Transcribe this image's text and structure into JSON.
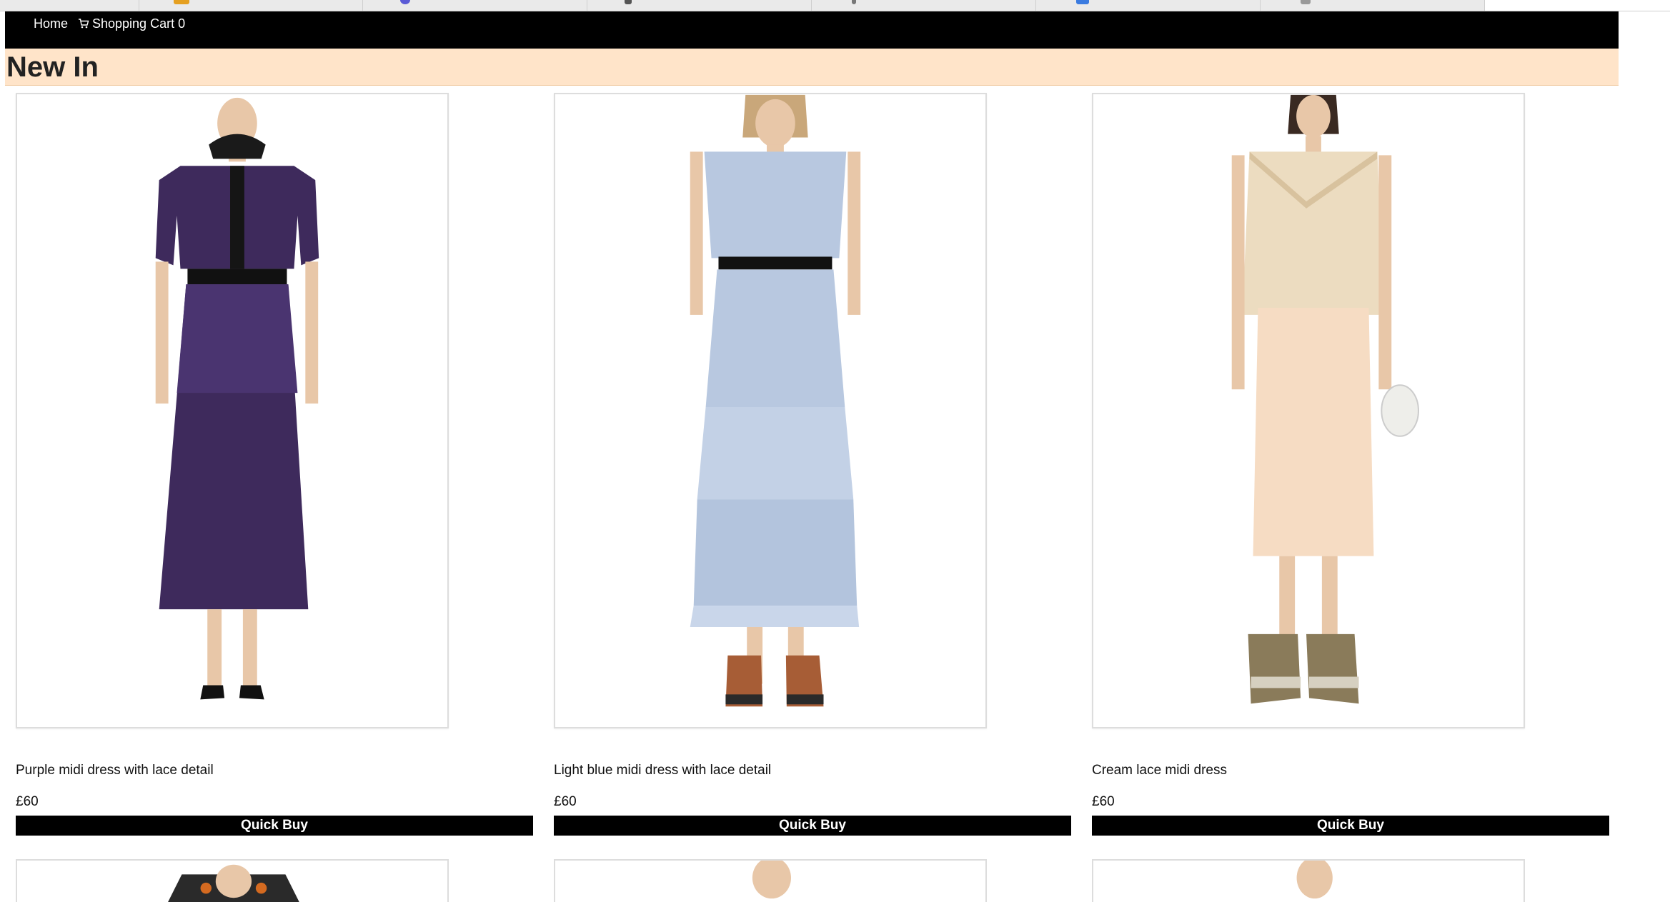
{
  "nav": {
    "home_label": "Home",
    "cart_label": "Shopping Cart 0",
    "cart_icon": "cart-icon"
  },
  "page": {
    "title": "New In"
  },
  "colors": {
    "nav_bg": "#000000",
    "heading_bg": "#ffe4c9",
    "button_bg": "#000000"
  },
  "products": [
    {
      "name": "Purple midi dress with lace detail",
      "price": "£60",
      "button_label": "Quick Buy",
      "dress_color": "#3e2a5c"
    },
    {
      "name": "Light blue midi dress with lace detail",
      "price": "£60",
      "button_label": "Quick Buy",
      "dress_color": "#b8c8e0"
    },
    {
      "name": "Cream lace midi dress",
      "price": "£60",
      "button_label": "Quick Buy",
      "dress_color": "#f6dcc3"
    }
  ]
}
